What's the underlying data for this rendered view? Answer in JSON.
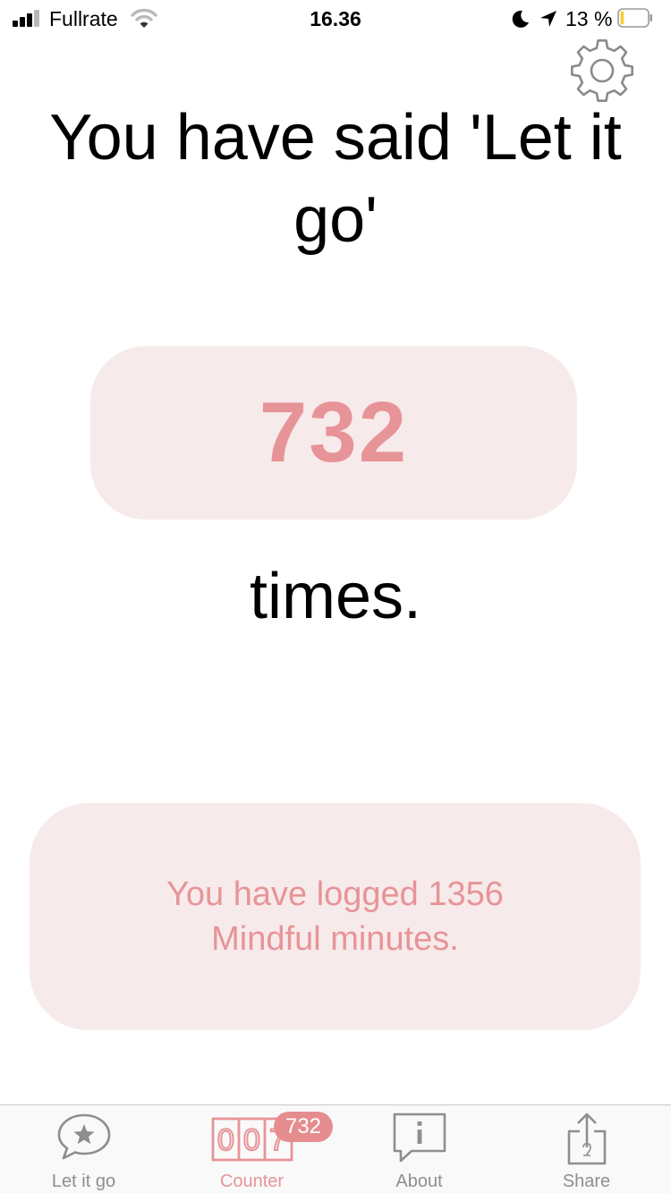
{
  "status_bar": {
    "carrier": "Fullrate",
    "time": "16.36",
    "battery_percent": "13 %",
    "battery_level": 0.13,
    "signal_bars": 3,
    "signal_bars_total": 4
  },
  "settings": {
    "icon": "gear-icon"
  },
  "main": {
    "headline": "You have said 'Let it go'",
    "count": "732",
    "suffix": "times.",
    "mindful_text": "You have logged 1356 Mindful minutes."
  },
  "tab_bar": {
    "tabs": [
      {
        "label": "Let it go",
        "icon": "speech-bubble-star-icon",
        "active": false
      },
      {
        "label": "Counter",
        "icon": "counter-icon",
        "active": true,
        "counter_digits": "007"
      },
      {
        "label": "About",
        "icon": "info-bubble-icon",
        "active": false
      },
      {
        "label": "Share",
        "icon": "share-icon",
        "active": false
      }
    ],
    "badge": "732"
  },
  "colors": {
    "accent": "#e79498",
    "box_background": "#f7eaea",
    "tab_inactive": "#8e8e8e",
    "badge": "#e58c8e"
  }
}
